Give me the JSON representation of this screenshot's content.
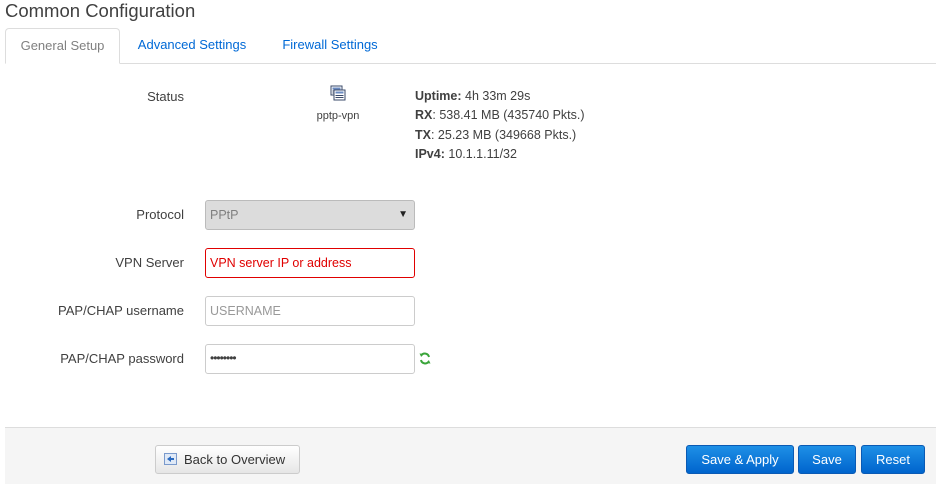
{
  "page": {
    "title": "Common Configuration"
  },
  "tabs": [
    {
      "label": "General Setup",
      "active": true
    },
    {
      "label": "Advanced Settings",
      "active": false
    },
    {
      "label": "Firewall Settings",
      "active": false
    }
  ],
  "status": {
    "label": "Status",
    "icon": "network-interface-icon",
    "ifname": "pptp-vpn",
    "uptime_label": "Uptime:",
    "uptime_value": " 4h 33m 29s",
    "rx_label": "RX",
    "rx_value": ": 538.41 MB (435740 Pkts.)",
    "tx_label": "TX",
    "tx_value": ": 25.23 MB (349668 Pkts.)",
    "ipv4_label": "IPv4:",
    "ipv4_value": " 10.1.1.11/32"
  },
  "form": {
    "protocol_label": "Protocol",
    "protocol_value": "PPtP",
    "server_label": "VPN Server",
    "server_placeholder": "VPN server IP or address",
    "username_label": "PAP/CHAP username",
    "username_placeholder": "USERNAME",
    "password_label": "PAP/CHAP password",
    "password_value": "••••••••"
  },
  "footer": {
    "back_label": "Back to Overview",
    "save_apply_label": "Save & Apply",
    "save_label": "Save",
    "reset_label": "Reset"
  },
  "colors": {
    "link": "#0069d6",
    "primary_button": "#0064cd",
    "error": "#e00000"
  }
}
